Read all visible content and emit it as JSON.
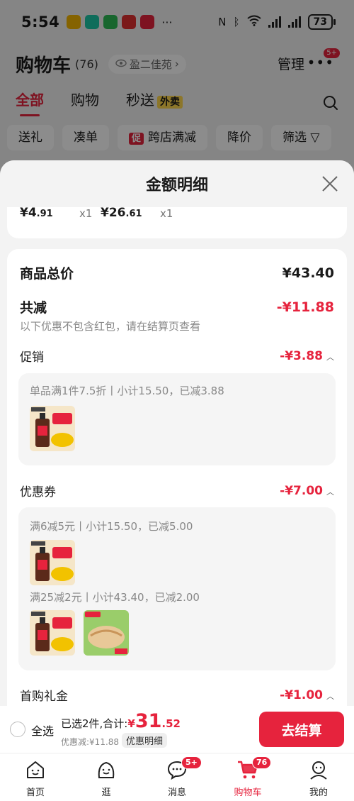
{
  "status_bar": {
    "time": "5:54",
    "more": "···",
    "battery": "73"
  },
  "cart_header": {
    "title": "购物车",
    "count": "(76)",
    "address": "盈二佳苑",
    "manage": "管理",
    "more_badge": "5+"
  },
  "category_tabs": [
    {
      "label": "全部"
    },
    {
      "label": "购物"
    },
    {
      "label": "秒送",
      "tag": "外卖"
    }
  ],
  "filter_chips": [
    {
      "label": "送礼"
    },
    {
      "label": "凑单"
    },
    {
      "label": "跨店满减",
      "prefix": "促"
    },
    {
      "label": "降价"
    },
    {
      "label": "筛选"
    }
  ],
  "sheet": {
    "title": "金额明细",
    "items": [
      {
        "price_main": "¥4",
        "price_dec": ".91",
        "qty": "x1"
      },
      {
        "price_main": "¥26",
        "price_dec": ".61",
        "qty": "x1"
      }
    ],
    "total_label": "商品总价",
    "total_value": "¥43.40",
    "reduce_label": "共减",
    "reduce_value": "-¥11.88",
    "reduce_note": "以下优惠不包含红包，请在结算页查看",
    "promo": {
      "label": "促销",
      "value": "-¥3.88",
      "line": "单品满1件7.5折丨小计15.50，已减3.88"
    },
    "coupon": {
      "label": "优惠券",
      "value": "-¥7.00",
      "line1": "满6减5元丨小计15.50，已减5.00",
      "line2": "满25减2元丨小计43.40，已减2.00"
    },
    "first_gift": {
      "label": "首购礼金",
      "value": "-¥1.00"
    }
  },
  "bottom_bar": {
    "select_all": "全选",
    "selected_text": "已选2件,合计:",
    "total_symbol": "¥",
    "total_int": "31",
    "total_dec": ".52",
    "discount": "优惠减:¥11.88",
    "detail_btn": "优惠明细",
    "checkout": "去结算"
  },
  "tab_bar": [
    {
      "label": "首页",
      "icon": "home-face-icon"
    },
    {
      "label": "逛",
      "icon": "stroll-face-icon"
    },
    {
      "label": "消息",
      "icon": "message-bubble-icon",
      "badge": "5+"
    },
    {
      "label": "购物车",
      "icon": "cart-icon",
      "badge": "76",
      "active": true
    },
    {
      "label": "我的",
      "icon": "profile-icon"
    }
  ],
  "colors": {
    "accent": "#e6233d",
    "mask": "rgba(0,0,0,0.45)"
  }
}
